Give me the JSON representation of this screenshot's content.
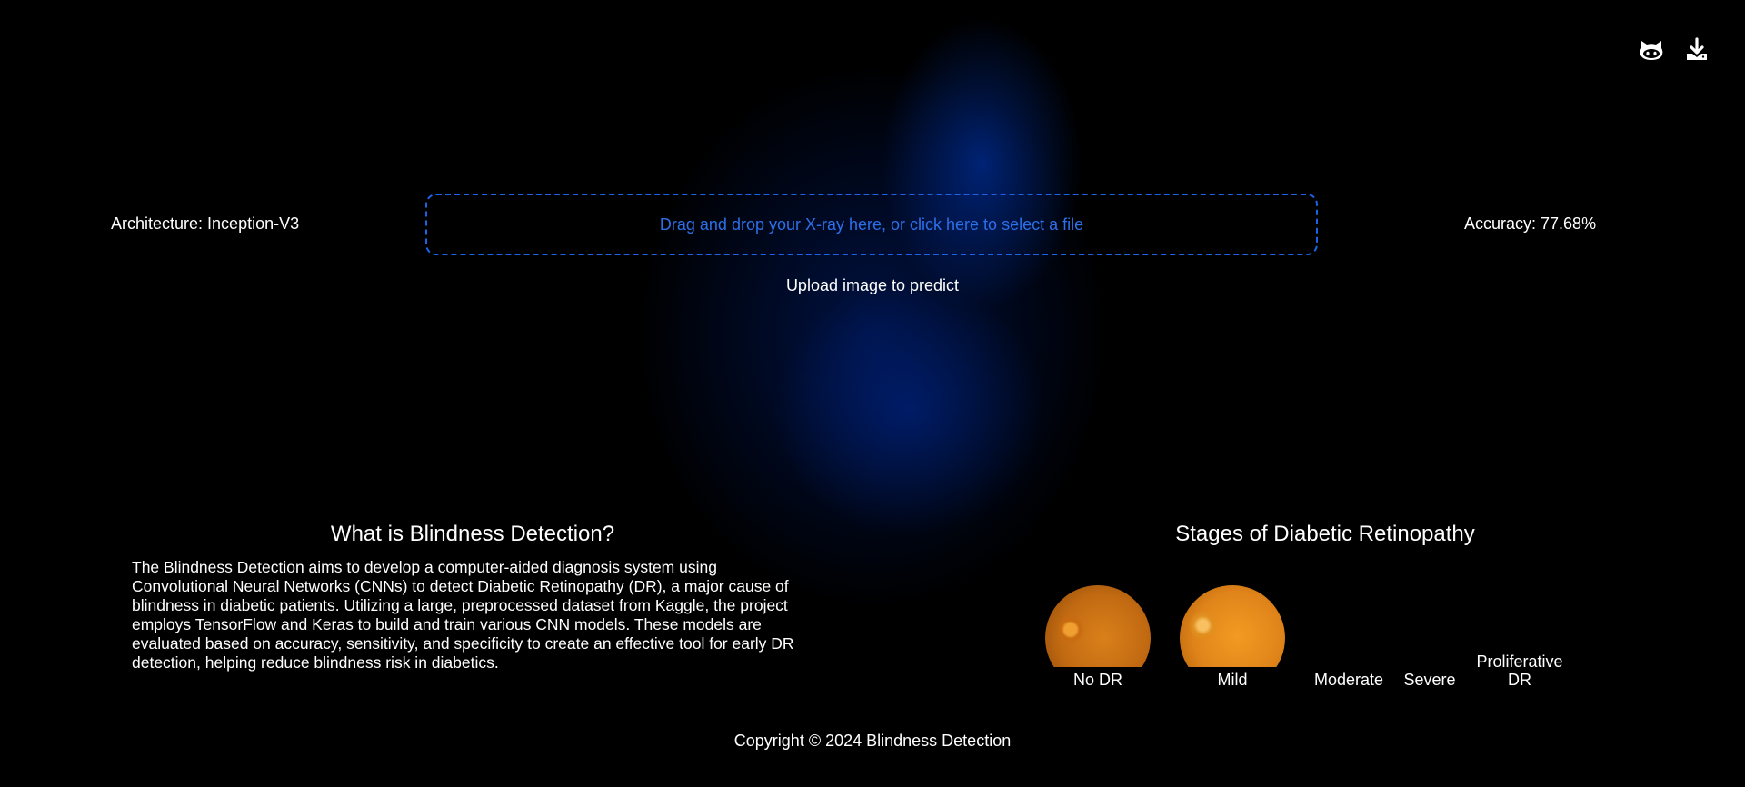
{
  "header": {
    "icons": [
      "github-icon",
      "download-icon"
    ]
  },
  "model": {
    "architecture_label": "Architecture: Inception-V3",
    "accuracy_label": "Accuracy: 77.68%"
  },
  "upload": {
    "dropzone_text": "Drag and drop your X-ray here, or click here to select a file",
    "hint": "Upload image to predict"
  },
  "about": {
    "title": "What is Blindness Detection?",
    "body": "The Blindness Detection aims to develop a computer-aided diagnosis system using Convolutional Neural Networks (CNNs) to detect Diabetic Retinopathy (DR), a major cause of blindness in diabetic patients. Utilizing a large, preprocessed dataset from Kaggle, the project employs TensorFlow and Keras to build and train various CNN models. These models are evaluated based on accuracy, sensitivity, and specificity to create an effective tool for early DR detection, helping reduce blindness risk in diabetics."
  },
  "stages": {
    "title": "Stages of Diabetic Retinopathy",
    "items": [
      {
        "label": "No DR",
        "has_image": true
      },
      {
        "label": "Mild",
        "has_image": true
      },
      {
        "label": "Moderate",
        "has_image": false
      },
      {
        "label": "Severe",
        "has_image": false
      },
      {
        "label": "Proliferative DR",
        "has_image": false
      }
    ]
  },
  "footer": {
    "copyright": "Copyright © 2024 Blindness Detection"
  },
  "colors": {
    "background": "#000000",
    "accent": "#1e63e6",
    "text": "#ffffff"
  }
}
